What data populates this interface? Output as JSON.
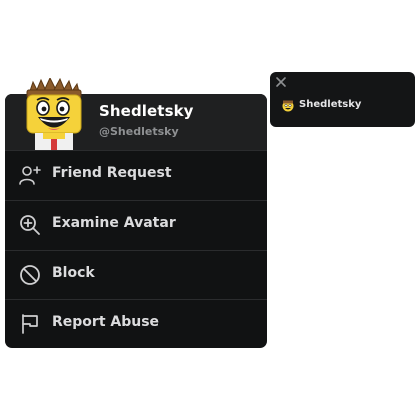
{
  "player_menu": {
    "display_name": "Shedletsky",
    "username": "@Shedletsky",
    "items": [
      {
        "label": "Friend Request",
        "icon": "add-friend-icon"
      },
      {
        "label": "Examine Avatar",
        "icon": "zoom-in-icon"
      },
      {
        "label": "Block",
        "icon": "block-icon"
      },
      {
        "label": "Report Abuse",
        "icon": "flag-icon"
      }
    ]
  },
  "name_card": {
    "name": "Shedletsky",
    "close_icon": "close-icon"
  },
  "colors": {
    "menu_bg": "#111213",
    "header_bg": "#1f2021",
    "text": "#dcdcde",
    "muted": "#8f9193",
    "avatar_skin": "#f5d23a"
  }
}
